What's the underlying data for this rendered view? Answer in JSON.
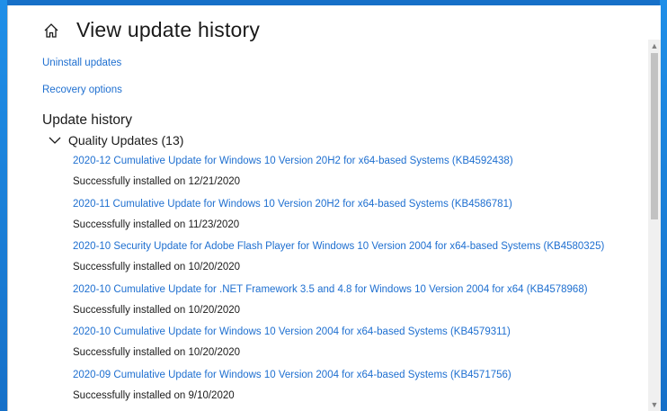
{
  "header": {
    "icon": "home-icon",
    "title": "View update history"
  },
  "links": {
    "uninstall": "Uninstall updates",
    "recovery": "Recovery options"
  },
  "history": {
    "section_title": "Update history",
    "group_label": "Quality Updates (13)",
    "updates": [
      {
        "title": "2020-12 Cumulative Update for Windows 10 Version 20H2 for x64-based Systems (KB4592438)",
        "status": "Successfully installed on 12/21/2020"
      },
      {
        "title": "2020-11 Cumulative Update for Windows 10 Version 20H2 for x64-based Systems (KB4586781)",
        "status": "Successfully installed on 11/23/2020"
      },
      {
        "title": "2020-10 Security Update for Adobe Flash Player for Windows 10 Version 2004 for x64-based Systems (KB4580325)",
        "status": "Successfully installed on 10/20/2020"
      },
      {
        "title": "2020-10 Cumulative Update for .NET Framework 3.5 and 4.8 for Windows 10 Version 2004 for x64 (KB4578968)",
        "status": "Successfully installed on 10/20/2020"
      },
      {
        "title": "2020-10 Cumulative Update for Windows 10 Version 2004 for x64-based Systems (KB4579311)",
        "status": "Successfully installed on 10/20/2020"
      },
      {
        "title": "2020-09 Cumulative Update for Windows 10 Version 2004 for x64-based Systems (KB4571756)",
        "status": "Successfully installed on 9/10/2020"
      }
    ]
  },
  "colors": {
    "link": "#1e6fd0",
    "text": "#1a1a1a",
    "accent": "#1670c8"
  }
}
